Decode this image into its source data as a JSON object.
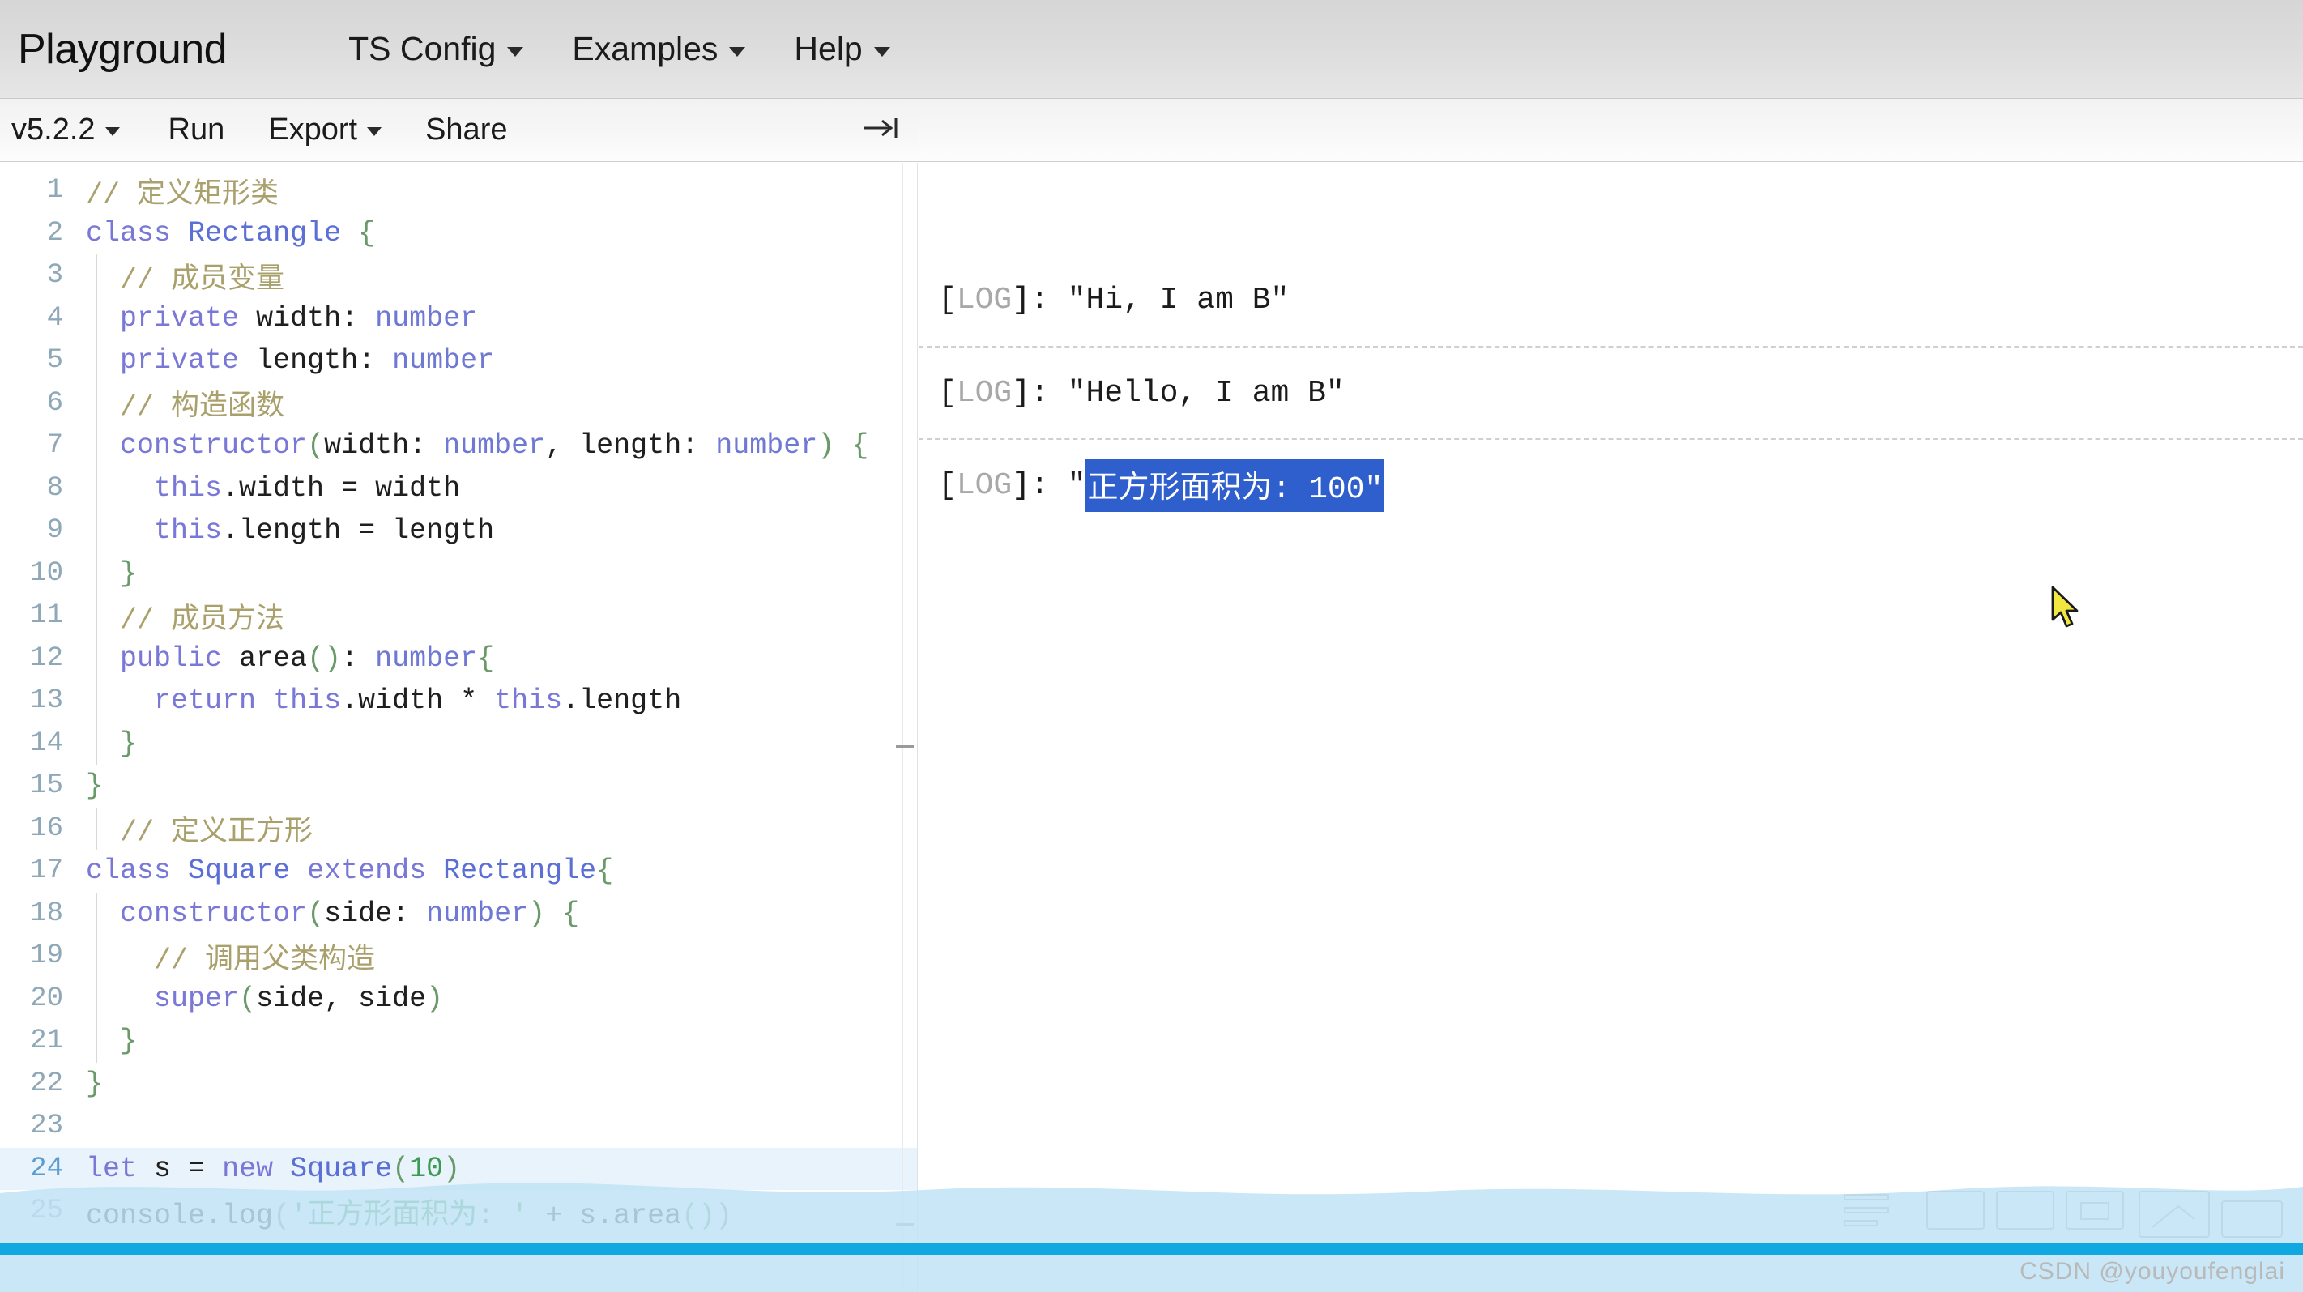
{
  "navbar": {
    "brand": "Playground",
    "items": [
      {
        "label": "TS Config",
        "has_caret": true
      },
      {
        "label": "Examples",
        "has_caret": true
      },
      {
        "label": "Help",
        "has_caret": true
      }
    ]
  },
  "toolbar": {
    "version": "v5.2.2",
    "run": "Run",
    "export": "Export",
    "share": "Share",
    "collapse_icon": "→|"
  },
  "editor": {
    "language": "TypeScript",
    "active_line": 24,
    "lines": [
      {
        "n": "1",
        "tokens": [
          {
            "t": "com",
            "v": "// 定义矩形类"
          }
        ],
        "indent": 0
      },
      {
        "n": "2",
        "tokens": [
          {
            "t": "kw",
            "v": "class"
          },
          {
            "t": "sp",
            "v": " "
          },
          {
            "t": "cls",
            "v": "Rectangle"
          },
          {
            "t": "sp",
            "v": " "
          },
          {
            "t": "punc",
            "v": "{"
          }
        ],
        "indent": 0
      },
      {
        "n": "3",
        "tokens": [
          {
            "t": "sp",
            "v": "  "
          },
          {
            "t": "com",
            "v": "// 成员变量"
          }
        ],
        "indent": 1
      },
      {
        "n": "4",
        "tokens": [
          {
            "t": "sp",
            "v": "  "
          },
          {
            "t": "kw",
            "v": "private"
          },
          {
            "t": "sp",
            "v": " "
          },
          {
            "t": "id",
            "v": "width"
          },
          {
            "t": "op",
            "v": ": "
          },
          {
            "t": "type",
            "v": "number"
          }
        ],
        "indent": 1
      },
      {
        "n": "5",
        "tokens": [
          {
            "t": "sp",
            "v": "  "
          },
          {
            "t": "kw",
            "v": "private"
          },
          {
            "t": "sp",
            "v": " "
          },
          {
            "t": "id",
            "v": "length"
          },
          {
            "t": "op",
            "v": ": "
          },
          {
            "t": "type",
            "v": "number"
          }
        ],
        "indent": 1
      },
      {
        "n": "6",
        "tokens": [
          {
            "t": "sp",
            "v": "  "
          },
          {
            "t": "com",
            "v": "// 构造函数"
          }
        ],
        "indent": 1
      },
      {
        "n": "7",
        "tokens": [
          {
            "t": "sp",
            "v": "  "
          },
          {
            "t": "kw",
            "v": "constructor"
          },
          {
            "t": "punc",
            "v": "("
          },
          {
            "t": "id",
            "v": "width"
          },
          {
            "t": "op",
            "v": ": "
          },
          {
            "t": "type",
            "v": "number"
          },
          {
            "t": "op",
            "v": ", "
          },
          {
            "t": "id",
            "v": "length"
          },
          {
            "t": "op",
            "v": ": "
          },
          {
            "t": "type",
            "v": "number"
          },
          {
            "t": "punc",
            "v": ") {"
          }
        ],
        "indent": 1
      },
      {
        "n": "8",
        "tokens": [
          {
            "t": "sp",
            "v": "    "
          },
          {
            "t": "kw",
            "v": "this"
          },
          {
            "t": "op",
            "v": "."
          },
          {
            "t": "id",
            "v": "width"
          },
          {
            "t": "op",
            "v": " = "
          },
          {
            "t": "id",
            "v": "width"
          }
        ],
        "indent": 2
      },
      {
        "n": "9",
        "tokens": [
          {
            "t": "sp",
            "v": "    "
          },
          {
            "t": "kw",
            "v": "this"
          },
          {
            "t": "op",
            "v": "."
          },
          {
            "t": "id",
            "v": "length"
          },
          {
            "t": "op",
            "v": " = "
          },
          {
            "t": "id",
            "v": "length"
          }
        ],
        "indent": 2
      },
      {
        "n": "10",
        "tokens": [
          {
            "t": "sp",
            "v": "  "
          },
          {
            "t": "punc",
            "v": "}"
          }
        ],
        "indent": 1
      },
      {
        "n": "11",
        "tokens": [
          {
            "t": "sp",
            "v": "  "
          },
          {
            "t": "com",
            "v": "// 成员方法"
          }
        ],
        "indent": 1
      },
      {
        "n": "12",
        "tokens": [
          {
            "t": "sp",
            "v": "  "
          },
          {
            "t": "kw",
            "v": "public"
          },
          {
            "t": "sp",
            "v": " "
          },
          {
            "t": "id",
            "v": "area"
          },
          {
            "t": "punc",
            "v": "()"
          },
          {
            "t": "op",
            "v": ": "
          },
          {
            "t": "type",
            "v": "number"
          },
          {
            "t": "punc",
            "v": "{"
          }
        ],
        "indent": 1
      },
      {
        "n": "13",
        "tokens": [
          {
            "t": "sp",
            "v": "    "
          },
          {
            "t": "kw",
            "v": "return"
          },
          {
            "t": "sp",
            "v": " "
          },
          {
            "t": "kw",
            "v": "this"
          },
          {
            "t": "op",
            "v": "."
          },
          {
            "t": "id",
            "v": "width"
          },
          {
            "t": "op",
            "v": " * "
          },
          {
            "t": "kw",
            "v": "this"
          },
          {
            "t": "op",
            "v": "."
          },
          {
            "t": "id",
            "v": "length"
          }
        ],
        "indent": 2
      },
      {
        "n": "14",
        "tokens": [
          {
            "t": "sp",
            "v": "  "
          },
          {
            "t": "punc",
            "v": "}"
          }
        ],
        "indent": 1
      },
      {
        "n": "15",
        "tokens": [
          {
            "t": "punc",
            "v": "}"
          }
        ],
        "indent": 0
      },
      {
        "n": "16",
        "tokens": [
          {
            "t": "sp",
            "v": "  "
          },
          {
            "t": "com",
            "v": "// 定义正方形"
          }
        ],
        "indent": 1
      },
      {
        "n": "17",
        "tokens": [
          {
            "t": "kw",
            "v": "class"
          },
          {
            "t": "sp",
            "v": " "
          },
          {
            "t": "cls",
            "v": "Square"
          },
          {
            "t": "sp",
            "v": " "
          },
          {
            "t": "kw",
            "v": "extends"
          },
          {
            "t": "sp",
            "v": " "
          },
          {
            "t": "cls",
            "v": "Rectangle"
          },
          {
            "t": "punc",
            "v": "{"
          }
        ],
        "indent": 0
      },
      {
        "n": "18",
        "tokens": [
          {
            "t": "sp",
            "v": "  "
          },
          {
            "t": "kw",
            "v": "constructor"
          },
          {
            "t": "punc",
            "v": "("
          },
          {
            "t": "id",
            "v": "side"
          },
          {
            "t": "op",
            "v": ": "
          },
          {
            "t": "type",
            "v": "number"
          },
          {
            "t": "punc",
            "v": ") {"
          }
        ],
        "indent": 1
      },
      {
        "n": "19",
        "tokens": [
          {
            "t": "sp",
            "v": "    "
          },
          {
            "t": "com",
            "v": "// 调用父类构造"
          }
        ],
        "indent": 2
      },
      {
        "n": "20",
        "tokens": [
          {
            "t": "sp",
            "v": "    "
          },
          {
            "t": "kw",
            "v": "super"
          },
          {
            "t": "punc",
            "v": "("
          },
          {
            "t": "id",
            "v": "side"
          },
          {
            "t": "op",
            "v": ", "
          },
          {
            "t": "id",
            "v": "side"
          },
          {
            "t": "punc",
            "v": ")"
          }
        ],
        "indent": 2
      },
      {
        "n": "21",
        "tokens": [
          {
            "t": "sp",
            "v": "  "
          },
          {
            "t": "punc",
            "v": "}"
          }
        ],
        "indent": 1
      },
      {
        "n": "22",
        "tokens": [
          {
            "t": "punc",
            "v": "}"
          }
        ],
        "indent": 0
      },
      {
        "n": "23",
        "tokens": [
          {
            "t": "sp",
            "v": ""
          }
        ],
        "indent": 0
      },
      {
        "n": "24",
        "tokens": [
          {
            "t": "kw",
            "v": "let"
          },
          {
            "t": "sp",
            "v": " "
          },
          {
            "t": "id",
            "v": "s"
          },
          {
            "t": "op",
            "v": " = "
          },
          {
            "t": "kw",
            "v": "new"
          },
          {
            "t": "sp",
            "v": " "
          },
          {
            "t": "cls",
            "v": "Square"
          },
          {
            "t": "punc",
            "v": "("
          },
          {
            "t": "num",
            "v": "10"
          },
          {
            "t": "punc",
            "v": ")"
          }
        ],
        "indent": 0
      },
      {
        "n": "25",
        "tokens": [
          {
            "t": "id",
            "v": "console"
          },
          {
            "t": "op",
            "v": "."
          },
          {
            "t": "id",
            "v": "log"
          },
          {
            "t": "punc",
            "v": "("
          },
          {
            "t": "str",
            "v": "'正方形面积为: '"
          },
          {
            "t": "op",
            "v": " + "
          },
          {
            "t": "id",
            "v": "s"
          },
          {
            "t": "op",
            "v": "."
          },
          {
            "t": "id",
            "v": "area"
          },
          {
            "t": "punc",
            "v": "())"
          }
        ],
        "indent": 0
      }
    ]
  },
  "output": {
    "logs": [
      {
        "tag": "[LOG]:",
        "label": "LOG",
        "text": "\"Hi, I am B\"",
        "selected": false
      },
      {
        "tag": "[LOG]:",
        "label": "LOG",
        "text": "\"Hello, I am B\"",
        "selected": false
      },
      {
        "tag": "[LOG]:",
        "label": "LOG",
        "prefix": "\"",
        "selected_text": "正方形面积为: 100\"",
        "selected": true
      }
    ]
  },
  "watermark": {
    "text": "CSDN @youyoufenglai"
  },
  "colors": {
    "selection_blue": "#2f5fcc",
    "active_line": "#e9f3fb",
    "wave_blue": "#10a8e0",
    "comment": "#a9a06b",
    "keyword": "#7a78d6",
    "string": "#3c9a52"
  }
}
